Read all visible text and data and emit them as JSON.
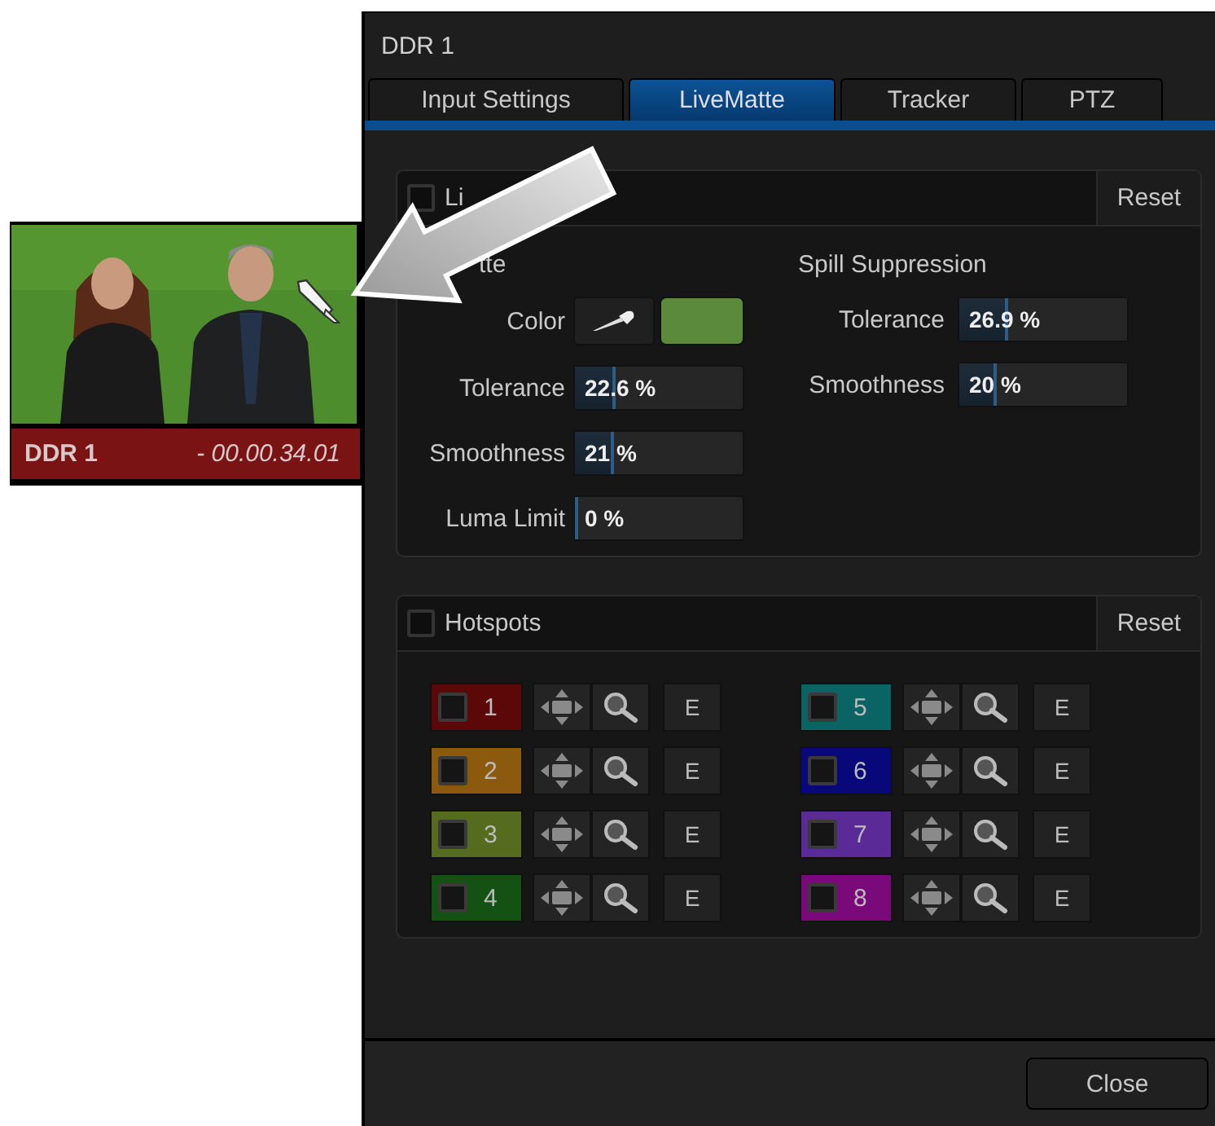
{
  "thumbnail": {
    "label": "DDR 1",
    "timecode": "- 00.00.34.01"
  },
  "window": {
    "title": "DDR 1"
  },
  "tabs": [
    {
      "label": "Input Settings",
      "selected": false
    },
    {
      "label": "LiveMatte",
      "selected": true
    },
    {
      "label": "Tracker",
      "selected": false
    },
    {
      "label": "PTZ",
      "selected": false
    }
  ],
  "matte_panel": {
    "title": "Li",
    "checked": false,
    "reset": "Reset",
    "left_heading": "tte",
    "color_row": {
      "label": "Color",
      "color": "#5b8a3c"
    },
    "left_fields": [
      {
        "label": "Tolerance",
        "value": "22.6 %",
        "level": 0.226
      },
      {
        "label": "Smoothness",
        "value": "21 %",
        "level": 0.21
      },
      {
        "label": "Luma Limit",
        "value": "0 %",
        "level": 0
      }
    ],
    "right_heading": "Spill Suppression",
    "right_fields": [
      {
        "label": "Tolerance",
        "value": "26.9 %",
        "level": 0.269
      },
      {
        "label": "Smoothness",
        "value": "20 %",
        "level": 0.2
      }
    ]
  },
  "hotspots_panel": {
    "title": "Hotspots",
    "checked": false,
    "reset": "Reset",
    "items": [
      {
        "number": "1",
        "color": "#5c0808",
        "checked": false,
        "edit": "E"
      },
      {
        "number": "2",
        "color": "#8c5a0c",
        "checked": false,
        "edit": "E"
      },
      {
        "number": "3",
        "color": "#556b1e",
        "checked": false,
        "edit": "E"
      },
      {
        "number": "4",
        "color": "#145214",
        "checked": false,
        "edit": "E"
      },
      {
        "number": "5",
        "color": "#0a6464",
        "checked": false,
        "edit": "E"
      },
      {
        "number": "6",
        "color": "#08087a",
        "checked": false,
        "edit": "E"
      },
      {
        "number": "7",
        "color": "#5a2a96",
        "checked": false,
        "edit": "E"
      },
      {
        "number": "8",
        "color": "#7a0a7a",
        "checked": false,
        "edit": "E"
      }
    ]
  },
  "footer": {
    "close": "Close"
  }
}
